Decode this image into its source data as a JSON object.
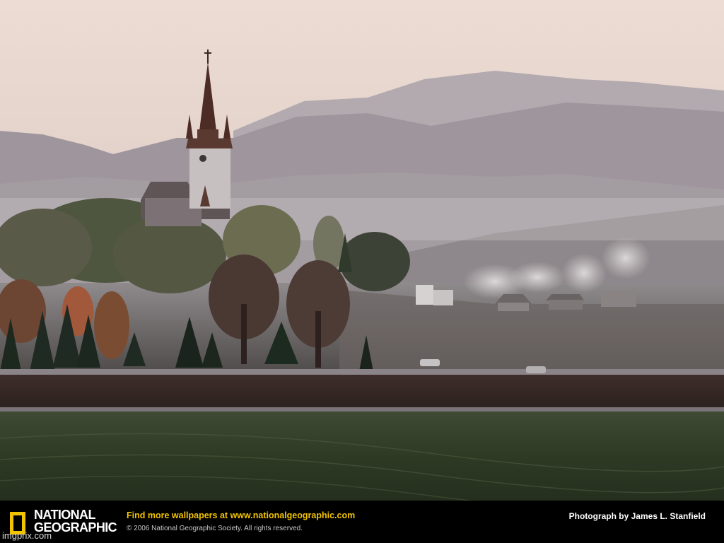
{
  "branding": {
    "logo_line_1": "NATIONAL",
    "logo_line_2": "GEOGRAPHIC",
    "accent_color": "#f2c400"
  },
  "footer": {
    "promo_text": "Find more wallpapers at",
    "promo_url": "www.nationalgeographic.com",
    "copyright": "© 2006 National Geographic Society. All rights reserved.",
    "credit": "Photograph by James L. Stanfield"
  },
  "watermark": "imgprix.com",
  "photo": {
    "icons": [
      "church-icon",
      "mountain-icon",
      "tree-icon",
      "car-icon",
      "smoke-icon"
    ]
  }
}
